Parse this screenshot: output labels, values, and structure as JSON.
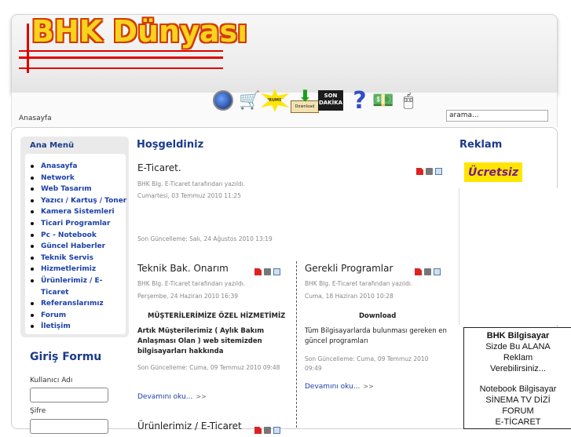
{
  "header": {
    "logo_text": "BHK Dünyası",
    "breadcrumb": "Anasayfa",
    "search_value": "arama...",
    "icons": [
      "home-icon",
      "cart-icon",
      "burst-icon",
      "download-icon",
      "news-icon",
      "question-icon",
      "money-icon",
      "mouse-icon"
    ],
    "burst_label": "KURUMSAL",
    "download_label": "Download",
    "news_label_1": "SON",
    "news_label_2": "DAKİKA"
  },
  "sidebar": {
    "menu_title": "Ana Menü",
    "items": [
      "Anasayfa",
      "Network",
      "Web Tasarım",
      "Yazıcı / Kartuş / Toner",
      "Kamera Sistemleri",
      "Ticari Programlar",
      "Pc - Notebook",
      "Güncel Haberler",
      "Teknik Servis",
      "Hizmetlerimiz",
      "Ürünlerimiz / E-Ticaret",
      "Referanslarımız",
      "Forum",
      "İletişim"
    ],
    "login_title": "Giriş Formu",
    "username_label": "Kullanıcı Adı",
    "password_label": "Şifre"
  },
  "main": {
    "title": "Hoşgeldiniz",
    "article1": {
      "title": "E-Ticaret.",
      "author": "BHK Blg. E-Ticaret tarafından yazıldı.",
      "date": "Cumartesi, 03 Temmuz 2010 11:25",
      "updated": "Son Güncelleme: Salı, 24 Ağustos 2010 13:19"
    },
    "article2": {
      "title": "Teknik Bak. Onarım",
      "author": "BHK Blg. E-Ticaret tarafından yazıldı.",
      "date": "Perşembe, 24 Haziran 2010 16:39",
      "heading": "MÜŞTERİLERİMİZE ÖZEL HİZMETİMİZ",
      "body": "Artık Müşterilerimiz ( Aylık Bakım Anlaşması Olan ) web sitemizden bilgisayarları hakkında",
      "updated": "Son Güncelleme: Cuma, 09 Temmuz 2010 09:48",
      "more": "Devamını oku...",
      "more_arrow": ">>"
    },
    "article3": {
      "title": "Gerekli Programlar",
      "author": "BHK Blg. E-Ticaret tarafından yazıldı.",
      "date": "Cuma, 18 Haziran 2010 10:28",
      "heading": "Download",
      "body": "Tüm Bilgisayarlarda bulunması gereken en güncel programları",
      "updated": "Son Güncelleme: Cuma, 09 Temmuz 2010 09:49",
      "more": "Devamını oku...",
      "more_arrow": ">>"
    },
    "article4": {
      "title": "Ürünlerimiz / E-Ticaret"
    }
  },
  "right": {
    "title": "Reklam",
    "badge": "Ücretsiz",
    "ad_lines": [
      "BHK Bilgisayar",
      "Sizde Bu ALANA",
      "Reklam",
      "Verebilirsiniz...",
      "",
      "Notebook Bilgisayar",
      "SİNEMA TV DİZİ",
      "FORUM",
      "E-TİCARET"
    ]
  }
}
